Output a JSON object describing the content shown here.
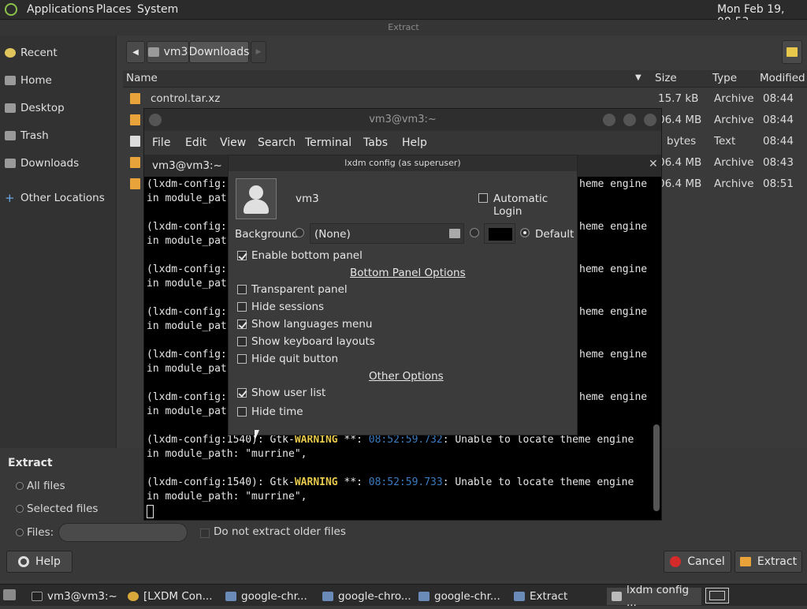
{
  "top_panel": {
    "applications": "Applications",
    "places": "Places",
    "system": "System",
    "clock": "Mon Feb 19, 08:53"
  },
  "extract_window": {
    "title": "Extract",
    "sidebar": {
      "items": [
        {
          "label": "Recent",
          "icon": "clock-icon"
        },
        {
          "label": "Home",
          "icon": "home-icon"
        },
        {
          "label": "Desktop",
          "icon": "desktop-icon"
        },
        {
          "label": "Trash",
          "icon": "trash-icon"
        },
        {
          "label": "Downloads",
          "icon": "folder-icon"
        },
        {
          "label": "Other Locations",
          "icon": "plus-icon"
        }
      ]
    },
    "path": {
      "segment1": "vm3",
      "segment2": "Downloads"
    },
    "columns": {
      "name": "Name",
      "size": "Size",
      "type": "Type",
      "modified": "Modified"
    },
    "files": [
      {
        "name": "control.tar.xz",
        "size": "15.7 kB",
        "type": "Archive",
        "modified": "08:44"
      },
      {
        "name": "",
        "size": "06.4 MB",
        "type": "Archive",
        "modified": "08:44"
      },
      {
        "name": "",
        "size": "bytes",
        "type": "Text",
        "modified": "08:44"
      },
      {
        "name": "",
        "size": "06.4 MB",
        "type": "Archive",
        "modified": "08:43"
      },
      {
        "name": "",
        "size": "06.4 MB",
        "type": "Archive",
        "modified": "08:51"
      }
    ],
    "extract_section": {
      "heading": "Extract",
      "all_files": "All files",
      "selected_files": "Selected files",
      "files_label": "Files:",
      "files_value": "",
      "do_not_extract_older": "Do not extract older files"
    },
    "buttons": {
      "help": "Help",
      "cancel": "Cancel",
      "extract": "Extract"
    }
  },
  "terminal": {
    "title": "vm3@vm3:~",
    "menu": [
      "File",
      "Edit",
      "View",
      "Search",
      "Terminal",
      "Tabs",
      "Help"
    ],
    "tab_label": "vm3@vm3:~",
    "lines": [
      {
        "a": "(lxdm-config:",
        "b": "heme engine"
      },
      {
        "a": "in module_path",
        "b": ""
      },
      {
        "a": "(lxdm-config:",
        "b": "heme engine"
      },
      {
        "a": "in module_path",
        "b": ""
      },
      {
        "a": "(lxdm-config:",
        "b": "heme engine"
      },
      {
        "a": "in module_path",
        "b": ""
      },
      {
        "a": "(lxdm-config:",
        "b": "heme engine"
      },
      {
        "a": "in module_path",
        "b": ""
      },
      {
        "a": "(lxdm-config:",
        "b": "heme engine"
      },
      {
        "a": "in module_path",
        "b": ""
      },
      {
        "a": "(lxdm-config:",
        "b": "heme engine"
      },
      {
        "a": "in module_path",
        "b": ""
      }
    ],
    "full_lines": [
      {
        "pre": "(lxdm-config:1540): Gtk-",
        "warn": "WARNING",
        "mid": " **: ",
        "ts": "08:52:59.732",
        "post": ": Unable to locate theme engine",
        "next": "in module_path: \"murrine\","
      },
      {
        "pre": "(lxdm-config:1540): Gtk-",
        "warn": "WARNING",
        "mid": " **: ",
        "ts": "08:52:59.733",
        "post": ": Unable to locate theme engine",
        "next": "in module_path: \"murrine\","
      }
    ]
  },
  "dialog": {
    "title": "lxdm config (as superuser)",
    "username": "vm3",
    "automatic_login": "Automatic Login",
    "background_label": "Background",
    "background_value": "(None)",
    "default_label": "Default",
    "enable_bottom_panel": "Enable bottom panel",
    "bottom_panel_options": "Bottom Panel Options",
    "transparent_panel": "Transparent panel",
    "hide_sessions": "Hide sessions",
    "show_languages_menu": "Show languages menu",
    "show_keyboard_layouts": "Show keyboard layouts",
    "hide_quit_button": "Hide quit button",
    "other_options": "Other Options",
    "show_user_list": "Show user list",
    "hide_time": "Hide time"
  },
  "taskbar": {
    "items": [
      {
        "label": "vm3@vm3:~",
        "icon": "terminal-icon"
      },
      {
        "label": "[LXDM Con...",
        "icon": "chrome-icon"
      },
      {
        "label": "google-chr...",
        "icon": "archive-icon"
      },
      {
        "label": "google-chro...",
        "icon": "archive-icon"
      },
      {
        "label": "google-chr...",
        "icon": "archive-icon"
      },
      {
        "label": "Extract",
        "icon": "archive-icon"
      },
      {
        "label": "lxdm config ...",
        "icon": "window-icon"
      }
    ]
  }
}
